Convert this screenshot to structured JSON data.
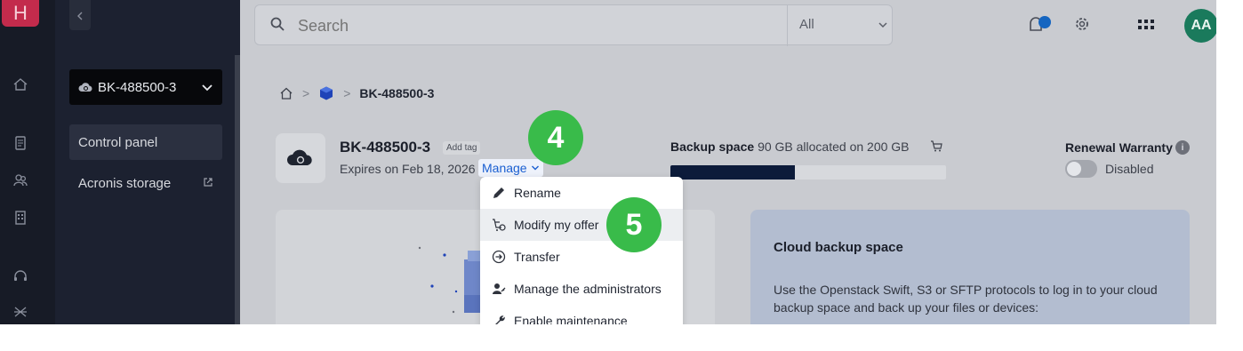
{
  "rail": {
    "logo_letter": "H",
    "icons": [
      "home-icon",
      "invoice-icon",
      "users-icon",
      "building-icon",
      "support-icon",
      "tools-icon"
    ]
  },
  "topbar": {
    "search_placeholder": "Search",
    "scope": "All",
    "avatar_initials": "AA"
  },
  "sidebar": {
    "project": "BK-488500-3",
    "items": [
      {
        "label": "Control panel",
        "active": true
      },
      {
        "label": "Acronis storage",
        "external": true
      }
    ]
  },
  "breadcrumb": {
    "current": "BK-488500-3"
  },
  "service": {
    "name": "BK-488500-3",
    "add_tag": "Add tag",
    "expires": "Expires on Feb 18, 2026",
    "manage": "Manage"
  },
  "backup": {
    "label": "Backup space",
    "value": "90 GB allocated on 200 GB",
    "fill_ratio": 0.45
  },
  "renewal": {
    "title": "Renewal Warranty",
    "info": "i",
    "status": "Disabled"
  },
  "card_right": {
    "title": "Cloud backup space",
    "text": "Use the Openstack Swift, S3 or SFTP protocols to log in to your cloud backup space and back up your files or devices:"
  },
  "menu": {
    "items": [
      {
        "label": "Rename",
        "icon": "pencil-icon"
      },
      {
        "label": "Modify my offer",
        "icon": "cart-icon"
      },
      {
        "label": "Transfer",
        "icon": "transfer-icon"
      },
      {
        "label": "Manage the administrators",
        "icon": "admins-icon"
      },
      {
        "label": "Enable maintenance",
        "icon": "wrench-icon"
      }
    ]
  },
  "steps": {
    "step4": "4",
    "step5": "5"
  },
  "colors": {
    "accent_blue": "#1a5fd1",
    "step_green": "#39bb4a",
    "logo_red": "#c32b4c",
    "progress_fill": "#0c1b3a"
  }
}
